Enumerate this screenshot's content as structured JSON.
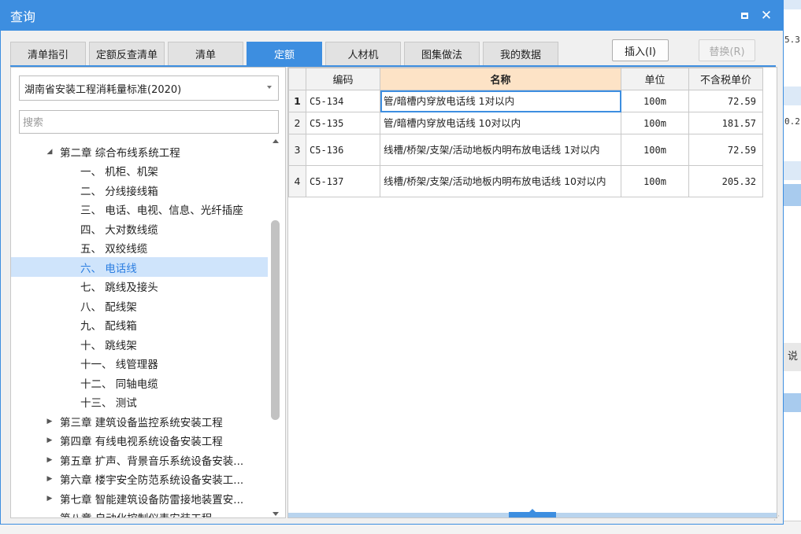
{
  "window": {
    "title": "查询"
  },
  "background": {
    "values": [
      "5.3",
      "0.2"
    ],
    "side_label": "说"
  },
  "tabs": [
    {
      "label": "清单指引",
      "active": false
    },
    {
      "label": "定额反查清单",
      "active": false
    },
    {
      "label": "清单",
      "active": false
    },
    {
      "label": "定额",
      "active": true
    },
    {
      "label": "人材机",
      "active": false
    },
    {
      "label": "图集做法",
      "active": false
    },
    {
      "label": "我的数据",
      "active": false
    }
  ],
  "actions": {
    "insert_label": "插入(I)",
    "replace_label": "替换(R)"
  },
  "left": {
    "standard": "湖南省安装工程消耗量标准(2020)",
    "search_placeholder": "搜索",
    "tree": [
      {
        "label": "第二章 综合布线系统工程",
        "arrow": "◢",
        "level": 0
      },
      {
        "label": "一、 机柜、机架",
        "level": 1
      },
      {
        "label": "二、 分线接线箱",
        "level": 1
      },
      {
        "label": "三、 电话、电视、信息、光纤插座",
        "level": 1
      },
      {
        "label": "四、 大对数线缆",
        "level": 1
      },
      {
        "label": "五、 双绞线缆",
        "level": 1
      },
      {
        "label": "六、 电话线",
        "level": 1,
        "selected": true
      },
      {
        "label": "七、 跳线及接头",
        "level": 1
      },
      {
        "label": "八、 配线架",
        "level": 1
      },
      {
        "label": "九、 配线箱",
        "level": 1
      },
      {
        "label": "十、 跳线架",
        "level": 1
      },
      {
        "label": "十一、 线管理器",
        "level": 1
      },
      {
        "label": "十二、 同轴电缆",
        "level": 1
      },
      {
        "label": "十三、 测试",
        "level": 1
      },
      {
        "label": "第三章 建筑设备监控系统安装工程",
        "arrow": "▶",
        "level": 0
      },
      {
        "label": "第四章 有线电视系统设备安装工程",
        "arrow": "▶",
        "level": 0
      },
      {
        "label": "第五章 扩声、背景音乐系统设备安装...",
        "arrow": "▶",
        "level": 0
      },
      {
        "label": "第六章 楼宇安全防范系统设备安装工...",
        "arrow": "▶",
        "level": 0
      },
      {
        "label": "第七章 智能建筑设备防雷接地装置安...",
        "arrow": "▶",
        "level": 0
      },
      {
        "label": "第八章 自动化控制仪表安装工程",
        "arrow": "",
        "level": 0
      }
    ]
  },
  "table": {
    "headers": {
      "code": "编码",
      "name": "名称",
      "unit": "单位",
      "price": "不含税单价"
    },
    "rows": [
      {
        "num": "1",
        "code": "C5-134",
        "name": "管/暗槽内穿放电话线 1对以内",
        "unit": "100m",
        "price": "72.59"
      },
      {
        "num": "2",
        "code": "C5-135",
        "name": "管/暗槽内穿放电话线 10对以内",
        "unit": "100m",
        "price": "181.57"
      },
      {
        "num": "3",
        "code": "C5-136",
        "name": "线槽/桥架/支架/活动地板内明布放电话线 1对以内",
        "unit": "100m",
        "price": "72.59"
      },
      {
        "num": "4",
        "code": "C5-137",
        "name": "线槽/桥架/支架/活动地板内明布放电话线 10对以内",
        "unit": "100m",
        "price": "205.32"
      }
    ]
  }
}
